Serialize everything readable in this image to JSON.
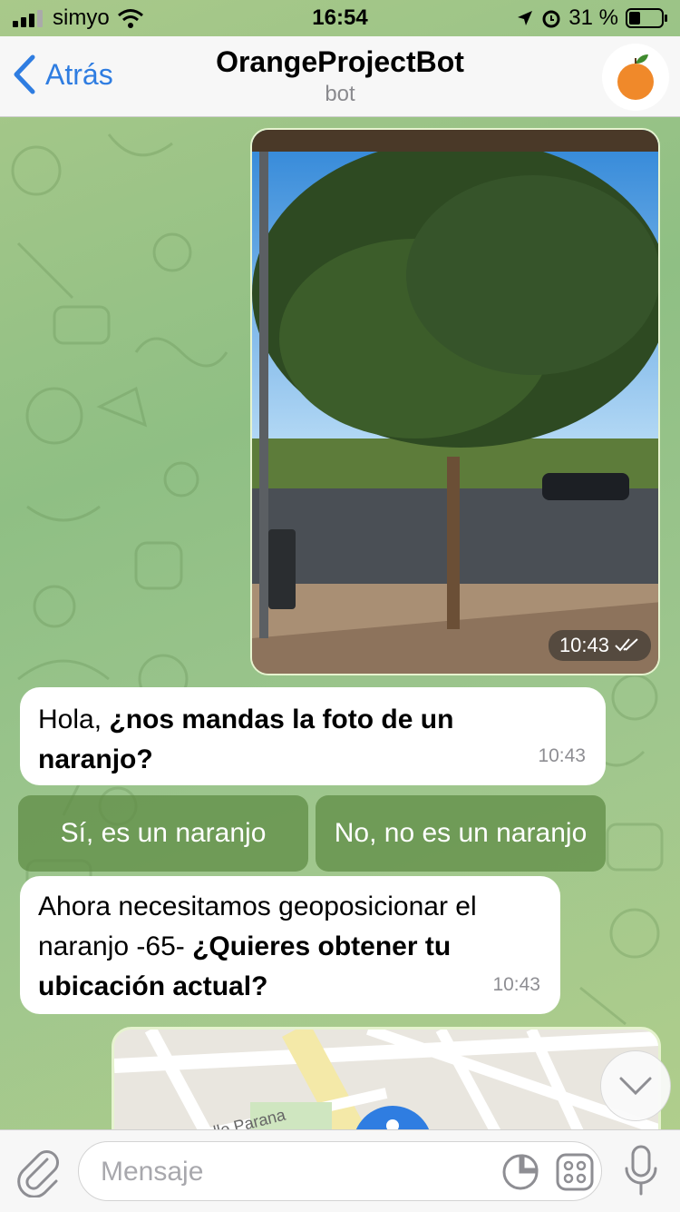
{
  "status_bar": {
    "carrier": "simyo",
    "time": "16:54",
    "battery": "31 %",
    "icons": [
      "signal-icon",
      "wifi-icon",
      "location-icon",
      "alarm-icon",
      "battery-icon"
    ]
  },
  "header": {
    "back_label": "Atrás",
    "title": "OrangeProjectBot",
    "subtitle": "bot",
    "avatar_icon": "orange-icon"
  },
  "messages": [
    {
      "type": "photo",
      "outgoing": true,
      "time": "10:43",
      "status_icon": "double-check-icon"
    },
    {
      "type": "text",
      "outgoing": false,
      "text_plain": "Hola, ",
      "text_bold": "¿nos mandas la foto de un naranjo?",
      "time": "10:43"
    },
    {
      "type": "text",
      "outgoing": false,
      "text_plain": "Ahora necesitamos geoposicionar el naranjo -65- ",
      "text_bold": "¿Quieres obtener tu ubicación actual?",
      "time": "10:43"
    },
    {
      "type": "location",
      "outgoing": true,
      "street_label": "Calle Parana"
    }
  ],
  "keyboard_buttons": [
    "Sí, es un naranjo",
    "No, no es un naranjo"
  ],
  "input": {
    "placeholder": "Mensaje"
  },
  "colors": {
    "accent": "#2f7de1",
    "bubble_in": "#ffffff",
    "keyboard_button": "#6f9a5a"
  }
}
